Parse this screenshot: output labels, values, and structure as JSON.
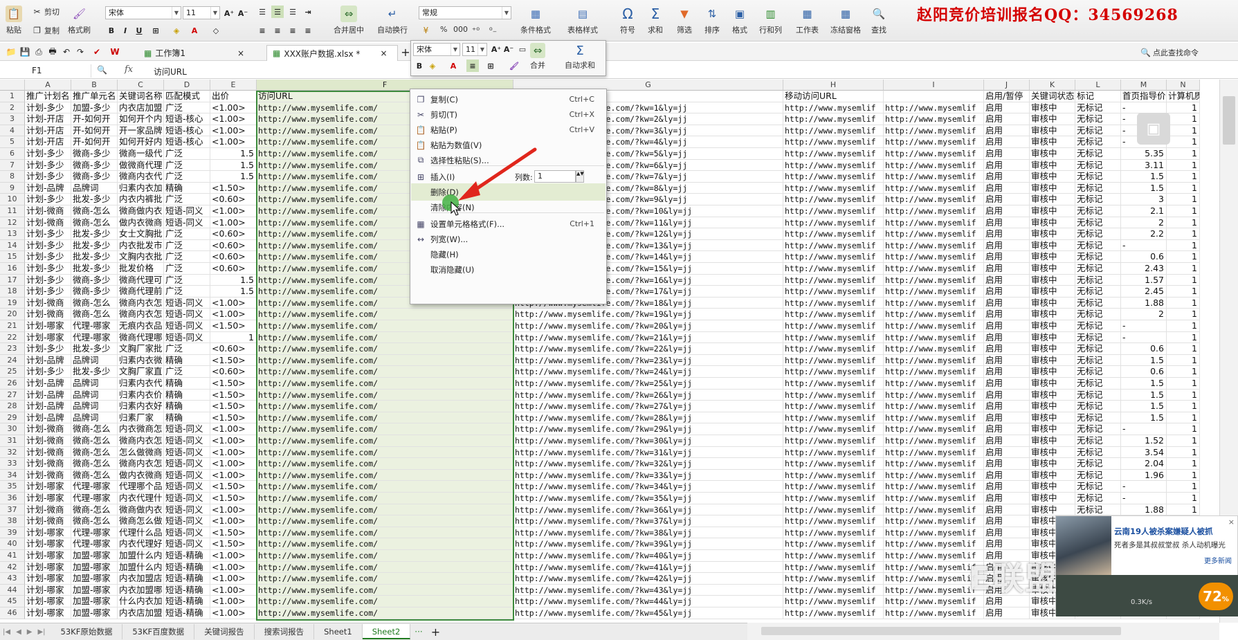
{
  "ribbon": {
    "paste": "粘贴",
    "cut": "剪切",
    "copy": "复制",
    "format_painter": "格式刷",
    "font_name": "宋体",
    "font_size": "11",
    "merge_center": "合并居中",
    "wrap_text": "自动换行",
    "number_format": "常规",
    "cond_format": "条件格式",
    "table_style": "表格样式",
    "symbol": "符号",
    "sum": "求和",
    "filter": "筛选",
    "sort": "排序",
    "format": "格式",
    "row_col": "行和列",
    "worksheet": "工作表",
    "freeze": "冻结窗格",
    "find": "查找",
    "percent": "%",
    "thousands": "000",
    "promo_text": "赵阳竞价培训报名QQ：34569268"
  },
  "quickbar": {
    "workbook_tab": "工作簿1",
    "file_tab": "XXX账户数据.xlsx *",
    "find_cmd": "点此查找命令"
  },
  "formula_bar": {
    "name_box": "F1",
    "fx": "fx",
    "content": "访问URL"
  },
  "mini_toolbar": {
    "font_name": "宋体",
    "font_size": "11",
    "merge": "合并",
    "autosum": "自动求和"
  },
  "context_menu": {
    "items": [
      {
        "label": "复制(C)",
        "shortcut": "Ctrl+C"
      },
      {
        "label": "剪切(T)",
        "shortcut": "Ctrl+X"
      },
      {
        "label": "粘贴(P)",
        "shortcut": "Ctrl+V"
      },
      {
        "label": "粘贴为数值(V)",
        "shortcut": ""
      },
      {
        "label": "选择性粘贴(S)...",
        "shortcut": ""
      },
      {
        "label": "插入(I)",
        "shortcut": ""
      },
      {
        "label": "删除(D)",
        "shortcut": ""
      },
      {
        "label": "清除内容(N)",
        "shortcut": ""
      },
      {
        "label": "设置单元格格式(F)...",
        "shortcut": "Ctrl+1"
      },
      {
        "label": "列宽(W)...",
        "shortcut": ""
      },
      {
        "label": "隐藏(H)",
        "shortcut": ""
      },
      {
        "label": "取消隐藏(U)",
        "shortcut": ""
      }
    ],
    "col_count_label": "列数:",
    "col_count_value": "1"
  },
  "columns": [
    "A",
    "B",
    "C",
    "D",
    "E",
    "F",
    "G",
    "H",
    "I",
    "J",
    "K",
    "L",
    "M",
    "N"
  ],
  "headers": [
    "推广计划名",
    "推广单元名",
    "关键词名称",
    "匹配模式",
    "出价",
    "访问URL",
    "",
    "移动访问URL",
    "",
    "启用/暂停",
    "关键词状态",
    "标记",
    "首页指导价",
    "计算机质量"
  ],
  "rows": [
    [
      "计划-多少",
      "加盟-多少",
      "内衣店加盟",
      "广泛",
      "<1.00>",
      "http://www.mysemlife.com/",
      "1",
      "http://www.mysemlif",
      "http://www.mysemlif",
      "启用",
      "审核中",
      "无标记",
      "-",
      "1"
    ],
    [
      "计划-开店",
      "开-如何开",
      "如何开个内",
      "短语-核心",
      "<1.00>",
      "http://www.mysemlife.com/",
      "2",
      "http://www.mysemlif",
      "http://www.mysemlif",
      "启用",
      "审核中",
      "无标记",
      "-",
      "1"
    ],
    [
      "计划-开店",
      "开-如何开",
      "开一家品牌",
      "短语-核心",
      "<1.00>",
      "http://www.mysemlife.com/",
      "3",
      "http://www.mysemlif",
      "http://www.mysemlif",
      "启用",
      "审核中",
      "无标记",
      "-",
      "1"
    ],
    [
      "计划-开店",
      "开-如何开",
      "如何开好内",
      "短语-核心",
      "<1.00>",
      "http://www.mysemlife.com/",
      "4",
      "http://www.mysemlif",
      "http://www.mysemlif",
      "启用",
      "审核中",
      "无标记",
      "-",
      "1"
    ],
    [
      "计划-多少",
      "微商-多少",
      "微商一级代",
      "广泛",
      "1.5",
      "http://www.mysemlife.com/",
      "5",
      "http://www.mysemlif",
      "http://www.mysemlif",
      "启用",
      "审核中",
      "无标记",
      "5.35",
      "1"
    ],
    [
      "计划-多少",
      "微商-多少",
      "做微商代理",
      "广泛",
      "1.5",
      "http://www.mysemlife.com/",
      "6",
      "http://www.mysemlif",
      "http://www.mysemlif",
      "启用",
      "审核中",
      "无标记",
      "3.11",
      "1"
    ],
    [
      "计划-多少",
      "微商-多少",
      "微商内衣代",
      "广泛",
      "1.5",
      "http://www.mysemlife.com/",
      "7",
      "http://www.mysemlif",
      "http://www.mysemlif",
      "启用",
      "审核中",
      "无标记",
      "1.5",
      "1"
    ],
    [
      "计划-品牌",
      "品牌词",
      "归素内衣加",
      "精确",
      "<1.50>",
      "http://www.mysemlife.com/",
      "8",
      "http://www.mysemlif",
      "http://www.mysemlif",
      "启用",
      "审核中",
      "无标记",
      "1.5",
      "1"
    ],
    [
      "计划-多少",
      "批发-多少",
      "内衣内裤批",
      "广泛",
      "<0.60>",
      "http://www.mysemlife.com/",
      "9",
      "http://www.mysemlif",
      "http://www.mysemlif",
      "启用",
      "审核中",
      "无标记",
      "3",
      "1"
    ],
    [
      "计划-微商",
      "微商-怎么",
      "微商做内衣",
      "短语-同义",
      "<1.00>",
      "http://www.mysemlife.com/",
      "10",
      "http://www.mysemlif",
      "http://www.mysemlif",
      "启用",
      "审核中",
      "无标记",
      "2.1",
      "1"
    ],
    [
      "计划-微商",
      "微商-怎么",
      "做内衣微商",
      "短语-同义",
      "<1.00>",
      "http://www.mysemlife.com/",
      "11",
      "http://www.mysemlif",
      "http://www.mysemlif",
      "启用",
      "审核中",
      "无标记",
      "2",
      "1"
    ],
    [
      "计划-多少",
      "批发-多少",
      "女士文胸批",
      "广泛",
      "<0.60>",
      "http://www.mysemlife.com/",
      "12",
      "http://www.mysemlif",
      "http://www.mysemlif",
      "启用",
      "审核中",
      "无标记",
      "2.2",
      "1"
    ],
    [
      "计划-多少",
      "批发-多少",
      "内衣批发市",
      "广泛",
      "<0.60>",
      "http://www.mysemlife.com/",
      "13",
      "http://www.mysemlif",
      "http://www.mysemlif",
      "启用",
      "审核中",
      "无标记",
      "-",
      "1"
    ],
    [
      "计划-多少",
      "批发-多少",
      "文胸内衣批",
      "广泛",
      "<0.60>",
      "http://www.mysemlife.com/",
      "14",
      "http://www.mysemlif",
      "http://www.mysemlif",
      "启用",
      "审核中",
      "无标记",
      "0.6",
      "1"
    ],
    [
      "计划-多少",
      "批发-多少",
      "批发价格",
      "广泛",
      "<0.60>",
      "http://www.mysemlife.com/",
      "15",
      "http://www.mysemlif",
      "http://www.mysemlif",
      "启用",
      "审核中",
      "无标记",
      "2.43",
      "1"
    ],
    [
      "计划-多少",
      "微商-多少",
      "微商代理可",
      "广泛",
      "1.5",
      "http://www.mysemlife.com/",
      "16",
      "http://www.mysemlif",
      "http://www.mysemlif",
      "启用",
      "审核中",
      "无标记",
      "1.57",
      "1"
    ],
    [
      "计划-多少",
      "微商-多少",
      "微商代理前",
      "广泛",
      "1.5",
      "http://www.mysemlife.com/",
      "17",
      "http://www.mysemlif",
      "http://www.mysemlif",
      "启用",
      "审核中",
      "无标记",
      "2.45",
      "1"
    ],
    [
      "计划-微商",
      "微商-怎么",
      "微商内衣怎",
      "短语-同义",
      "<1.00>",
      "http://www.mysemlife.com/",
      "18",
      "http://www.mysemlif",
      "http://www.mysemlif",
      "启用",
      "审核中",
      "无标记",
      "1.88",
      "1"
    ],
    [
      "计划-微商",
      "微商-怎么",
      "微商内衣怎",
      "短语-同义",
      "<1.00>",
      "http://www.mysemlife.com/",
      "19",
      "http://www.mysemlif",
      "http://www.mysemlif",
      "启用",
      "审核中",
      "无标记",
      "2",
      "1"
    ],
    [
      "计划-哪家",
      "代理-哪家",
      "无痕内衣品",
      "短语-同义",
      "<1.50>",
      "http://www.mysemlife.com/",
      "20",
      "http://www.mysemlif",
      "http://www.mysemlif",
      "启用",
      "审核中",
      "无标记",
      "-",
      "1"
    ],
    [
      "计划-哪家",
      "代理-哪家",
      "微商代理哪",
      "短语-同义",
      "1",
      "http://www.mysemlife.com/",
      "21",
      "http://www.mysemlif",
      "http://www.mysemlif",
      "启用",
      "审核中",
      "无标记",
      "-",
      "1"
    ],
    [
      "计划-多少",
      "批发-多少",
      "文胸厂家批",
      "广泛",
      "<0.60>",
      "http://www.mysemlife.com/",
      "22",
      "http://www.mysemlif",
      "http://www.mysemlif",
      "启用",
      "审核中",
      "无标记",
      "0.6",
      "1"
    ],
    [
      "计划-品牌",
      "品牌词",
      "归素内衣微",
      "精确",
      "<1.50>",
      "http://www.mysemlife.com/",
      "23",
      "http://www.mysemlif",
      "http://www.mysemlif",
      "启用",
      "审核中",
      "无标记",
      "1.5",
      "1"
    ],
    [
      "计划-多少",
      "批发-多少",
      "文胸厂家直",
      "广泛",
      "<0.60>",
      "http://www.mysemlife.com/",
      "24",
      "http://www.mysemlif",
      "http://www.mysemlif",
      "启用",
      "审核中",
      "无标记",
      "0.6",
      "1"
    ],
    [
      "计划-品牌",
      "品牌词",
      "归素内衣代",
      "精确",
      "<1.50>",
      "http://www.mysemlife.com/",
      "25",
      "http://www.mysemlif",
      "http://www.mysemlif",
      "启用",
      "审核中",
      "无标记",
      "1.5",
      "1"
    ],
    [
      "计划-品牌",
      "品牌词",
      "归素内衣价",
      "精确",
      "<1.50>",
      "http://www.mysemlife.com/",
      "26",
      "http://www.mysemlif",
      "http://www.mysemlif",
      "启用",
      "审核中",
      "无标记",
      "1.5",
      "1"
    ],
    [
      "计划-品牌",
      "品牌词",
      "归素内衣好",
      "精确",
      "<1.50>",
      "http://www.mysemlife.com/",
      "27",
      "http://www.mysemlif",
      "http://www.mysemlif",
      "启用",
      "审核中",
      "无标记",
      "1.5",
      "1"
    ],
    [
      "计划-品牌",
      "品牌词",
      "归素厂家",
      "精确",
      "<1.50>",
      "http://www.mysemlife.com/",
      "28",
      "http://www.mysemlif",
      "http://www.mysemlif",
      "启用",
      "审核中",
      "无标记",
      "1.5",
      "1"
    ],
    [
      "计划-微商",
      "微商-怎么",
      "内衣微商怎",
      "短语-同义",
      "<1.00>",
      "http://www.mysemlife.com/",
      "29",
      "http://www.mysemlif",
      "http://www.mysemlif",
      "启用",
      "审核中",
      "无标记",
      "-",
      "1"
    ],
    [
      "计划-微商",
      "微商-怎么",
      "微商内衣怎",
      "短语-同义",
      "<1.00>",
      "http://www.mysemlife.com/",
      "30",
      "http://www.mysemlif",
      "http://www.mysemlif",
      "启用",
      "审核中",
      "无标记",
      "1.52",
      "1"
    ],
    [
      "计划-微商",
      "微商-怎么",
      "怎么做微商",
      "短语-同义",
      "<1.00>",
      "http://www.mysemlife.com/",
      "31",
      "http://www.mysemlif",
      "http://www.mysemlif",
      "启用",
      "审核中",
      "无标记",
      "3.54",
      "1"
    ],
    [
      "计划-微商",
      "微商-怎么",
      "微商内衣怎",
      "短语-同义",
      "<1.00>",
      "http://www.mysemlife.com/",
      "32",
      "http://www.mysemlif",
      "http://www.mysemlif",
      "启用",
      "审核中",
      "无标记",
      "2.04",
      "1"
    ],
    [
      "计划-微商",
      "微商-怎么",
      "做内衣微商",
      "短语-同义",
      "<1.00>",
      "http://www.mysemlife.com/",
      "33",
      "http://www.mysemlif",
      "http://www.mysemlif",
      "启用",
      "审核中",
      "无标记",
      "1.96",
      "1"
    ],
    [
      "计划-哪家",
      "代理-哪家",
      "代理哪个品",
      "短语-同义",
      "<1.50>",
      "http://www.mysemlife.com/",
      "34",
      "http://www.mysemlif",
      "http://www.mysemlif",
      "启用",
      "审核中",
      "无标记",
      "-",
      "1"
    ],
    [
      "计划-哪家",
      "代理-哪家",
      "内衣代理什",
      "短语-同义",
      "<1.50>",
      "http://www.mysemlife.com/",
      "35",
      "http://www.mysemlif",
      "http://www.mysemlif",
      "启用",
      "审核中",
      "无标记",
      "-",
      "1"
    ],
    [
      "计划-微商",
      "微商-怎么",
      "微商做内衣",
      "短语-同义",
      "<1.00>",
      "http://www.mysemlife.com/",
      "36",
      "http://www.mysemlif",
      "http://www.mysemlif",
      "启用",
      "审核中",
      "无标记",
      "1.88",
      "1"
    ],
    [
      "计划-微商",
      "微商-怎么",
      "微商怎么做",
      "短语-同义",
      "<1.00>",
      "http://www.mysemlife.com/",
      "37",
      "http://www.mysemlif",
      "http://www.mysemlif",
      "启用",
      "审核中",
      "无标记",
      "",
      "1"
    ],
    [
      "计划-哪家",
      "代理-哪家",
      "代理什么品",
      "短语-同义",
      "<1.50>",
      "http://www.mysemlife.com/",
      "38",
      "http://www.mysemlif",
      "http://www.mysemlif",
      "启用",
      "审核中",
      "无标记",
      "",
      "1"
    ],
    [
      "计划-哪家",
      "代理-哪家",
      "内衣代理好",
      "短语-同义",
      "<1.50>",
      "http://www.mysemlife.com/",
      "39",
      "http://www.mysemlif",
      "http://www.mysemlif",
      "启用",
      "审核中",
      "无标记",
      "",
      "1"
    ],
    [
      "计划-哪家",
      "加盟-哪家",
      "加盟什么内",
      "短语-精确",
      "<1.00>",
      "http://www.mysemlife.com/",
      "40",
      "http://www.mysemlif",
      "http://www.mysemlif",
      "启用",
      "审核中",
      "无标记",
      "",
      "1"
    ],
    [
      "计划-哪家",
      "加盟-哪家",
      "加盟什么内",
      "短语-精确",
      "<1.00>",
      "http://www.mysemlife.com/",
      "41",
      "http://www.mysemlif",
      "http://www.mysemlif",
      "启用",
      "审核中",
      "无标记",
      "",
      "1"
    ],
    [
      "计划-哪家",
      "加盟-哪家",
      "内衣加盟店",
      "短语-精确",
      "<1.00>",
      "http://www.mysemlife.com/",
      "42",
      "http://www.mysemlif",
      "http://www.mysemlif",
      "启用",
      "审核中",
      "无标记",
      "",
      "1"
    ],
    [
      "计划-哪家",
      "加盟-哪家",
      "内衣加盟哪",
      "短语-精确",
      "<1.00>",
      "http://www.mysemlife.com/",
      "43",
      "http://www.mysemlif",
      "http://www.mysemlif",
      "启用",
      "审核中",
      "无标记",
      "",
      "1"
    ],
    [
      "计划-哪家",
      "加盟-哪家",
      "什么内衣加",
      "短语-精确",
      "<1.00>",
      "http://www.mysemlife.com/",
      "44",
      "http://www.mysemlif",
      "http://www.mysemlif",
      "启用",
      "审核中",
      "无标记",
      "",
      "1"
    ],
    [
      "计划-哪家",
      "加盟-哪家",
      "内衣店加盟",
      "短语-精确",
      "<1.00>",
      "http://www.mysemlife.com/",
      "45",
      "http://www.mysemlif",
      "http://www.mysemlif",
      "启用",
      "审核中",
      "无标记",
      "",
      "1"
    ]
  ],
  "url_g_prefix": "http://www.mysemlife.com/?kw=",
  "url_g_suffix": "&ly=jj",
  "url_g_visible_prefix": "fe.com/?kw=",
  "sheet_tabs": [
    "53KF原始数据",
    "53KF百度数据",
    "关键词报告",
    "搜索词报告",
    "Sheet1",
    "Sheet2"
  ],
  "active_sheet": "Sheet2",
  "news": {
    "headline": "云南19人被杀案嫌疑人被抓",
    "sub": "死者多是其叔叔堂叔 杀人动机曝光",
    "more": "更多新闻",
    "speed": "0.3K/s"
  },
  "badge": "72",
  "watermark": "E联盟"
}
